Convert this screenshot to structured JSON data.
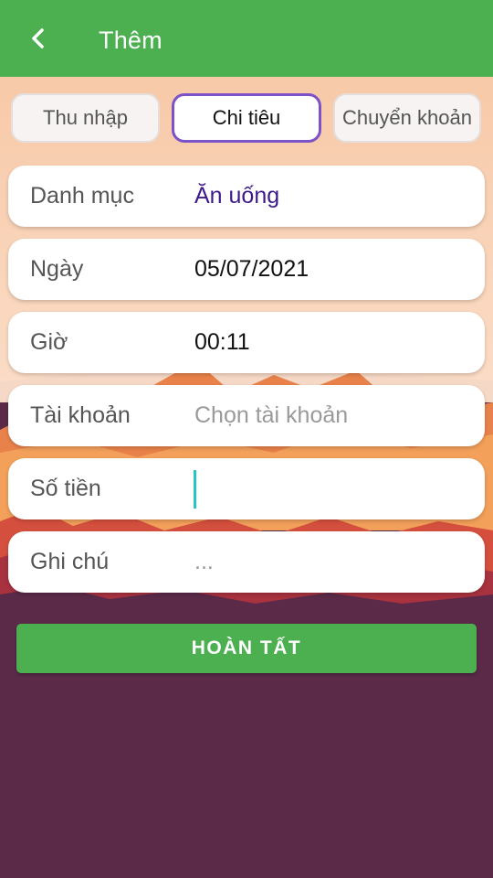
{
  "header": {
    "title": "Thêm",
    "back_icon": "chevron-left-icon"
  },
  "tabs": [
    {
      "label": "Thu nhập",
      "active": false
    },
    {
      "label": "Chi tiêu",
      "active": true
    },
    {
      "label": "Chuyển khoản",
      "active": false
    }
  ],
  "form": {
    "category": {
      "label": "Danh mục",
      "value": "Ăn uống"
    },
    "date": {
      "label": "Ngày",
      "value": "05/07/2021"
    },
    "time": {
      "label": "Giờ",
      "value": "00:11"
    },
    "account": {
      "label": "Tài khoản",
      "placeholder": "Chọn tài khoản"
    },
    "amount": {
      "label": "Số tiền",
      "value": ""
    },
    "note": {
      "label": "Ghi chú",
      "placeholder": "..."
    }
  },
  "submit": {
    "label": "HOÀN TẤT"
  },
  "colors": {
    "primary_green": "#4caf50",
    "active_tab_border": "#7c52c9",
    "category_text": "#3d1a8c",
    "cursor": "#26c6c6",
    "background_purple": "#5b2a49"
  }
}
